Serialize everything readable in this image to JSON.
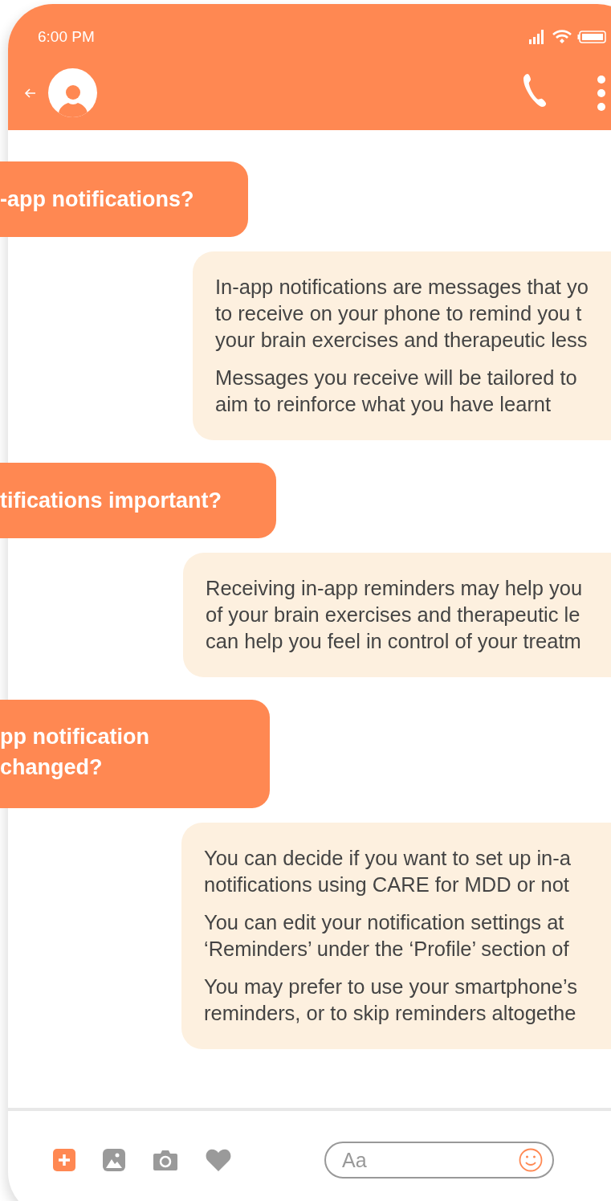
{
  "status_bar": {
    "time": "6:00 PM"
  },
  "messages": [
    {
      "kind": "sent",
      "lines": [
        "-app notifications?"
      ]
    },
    {
      "kind": "received",
      "paragraphs": [
        [
          "In-app notifications are messages that yo",
          "to receive on your phone to remind you t",
          "your brain exercises and therapeutic less"
        ],
        [
          "Messages you receive will be tailored to",
          "aim to reinforce what you have learnt"
        ]
      ]
    },
    {
      "kind": "sent",
      "lines": [
        "tifications important?"
      ]
    },
    {
      "kind": "received",
      "paragraphs": [
        [
          "Receiving in-app reminders may help you",
          "of your brain exercises and therapeutic le",
          "can help you feel in control of your treatm"
        ]
      ]
    },
    {
      "kind": "sent",
      "lines": [
        "pp notification",
        "changed?"
      ]
    },
    {
      "kind": "received",
      "paragraphs": [
        [
          "You can decide if you want to set up in-a",
          "notifications using CARE for MDD or not"
        ],
        [
          "You can edit your notification settings at",
          "‘Reminders’ under the ‘Profile’ section of"
        ],
        [
          "You may prefer to use your smartphone’s",
          "reminders, or to skip reminders altogethe"
        ]
      ]
    }
  ],
  "composer": {
    "placeholder": "Aa"
  }
}
